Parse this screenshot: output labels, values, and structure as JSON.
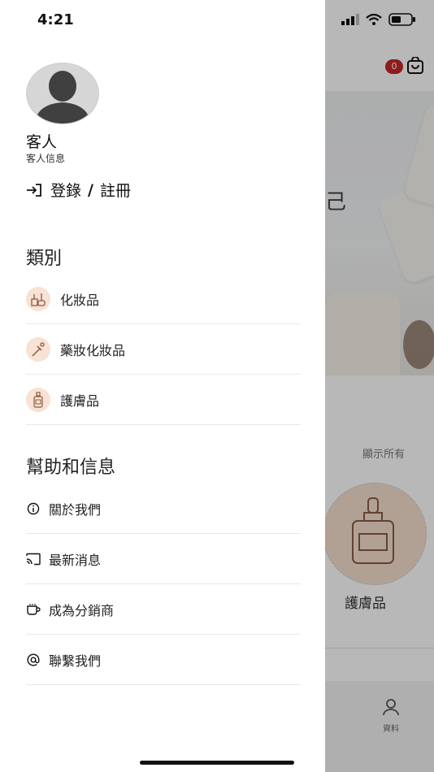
{
  "status_bar": {
    "time": "4:21"
  },
  "background": {
    "cart_count": "0",
    "banner_char": "己",
    "show_all": "顯示所有",
    "category_label": "護膚品",
    "tab_profile": "資料"
  },
  "drawer": {
    "user": {
      "name": "客人",
      "subtitle": "客人信息"
    },
    "auth": {
      "login": "登錄",
      "separator": "/",
      "register": "註冊"
    },
    "categories": {
      "title": "類別",
      "items": [
        {
          "label": "化妝品",
          "icon": "cosmetics-icon"
        },
        {
          "label": "藥妝化妝品",
          "icon": "pharma-cosmetics-icon"
        },
        {
          "label": "護膚品",
          "icon": "skincare-icon"
        }
      ]
    },
    "help": {
      "title": "幫助和信息",
      "items": [
        {
          "label": "關於我們",
          "icon": "info-icon"
        },
        {
          "label": "最新消息",
          "icon": "cast-icon"
        },
        {
          "label": "成為分銷商",
          "icon": "cup-icon"
        },
        {
          "label": "聯繫我們",
          "icon": "at-icon"
        }
      ]
    }
  },
  "colors": {
    "accent_circle": "#f7e2d3",
    "badge": "#c62828",
    "icon_brown": "#8a5a44"
  }
}
